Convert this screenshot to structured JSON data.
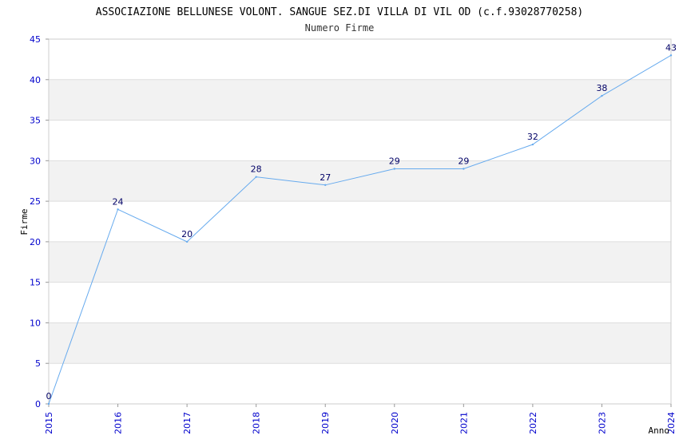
{
  "chart_data": {
    "type": "line",
    "title": "ASSOCIAZIONE BELLUNESE VOLONT. SANGUE SEZ.DI VILLA DI VIL OD (c.f.93028770258)",
    "subtitle": "Numero Firme",
    "xlabel": "Anno",
    "ylabel": "Firme",
    "categories": [
      "2015",
      "2016",
      "2017",
      "2018",
      "2019",
      "2020",
      "2021",
      "2022",
      "2023",
      "2024"
    ],
    "series": [
      {
        "values": [
          0,
          24,
          20,
          28,
          27,
          29,
          29,
          32,
          38,
          43
        ]
      }
    ],
    "ylim": [
      0,
      45
    ],
    "yticks": [
      0,
      5,
      10,
      15,
      20,
      25,
      30,
      35,
      40,
      45
    ],
    "grid": "horizontal bands",
    "line_color": "#66aaee",
    "tick_color": "#0000cc",
    "band_color": "#f2f2f2"
  }
}
